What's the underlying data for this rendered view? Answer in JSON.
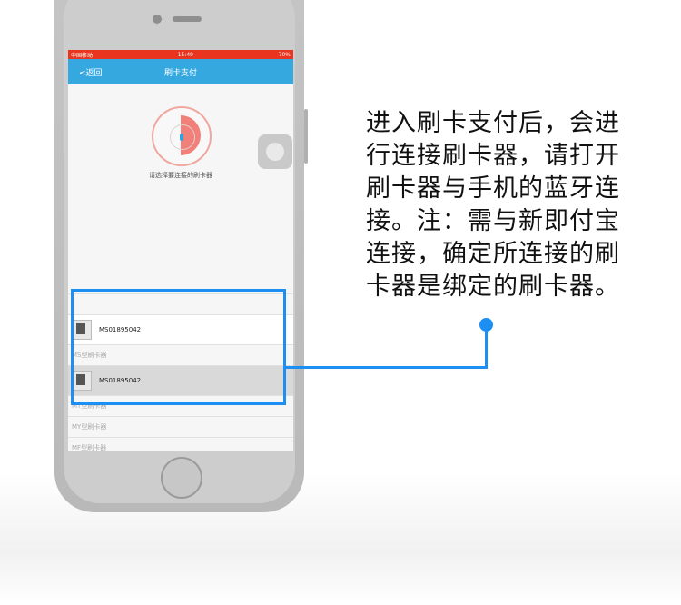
{
  "status": {
    "left": "中国移动",
    "time": "15:49",
    "right": "70%"
  },
  "nav": {
    "back_label": "<返回",
    "title": "刷卡支付"
  },
  "prompt": "请选择要连接的刷卡器",
  "devices": [
    {
      "id": "MS01895042",
      "selected": false
    },
    {
      "id": "MS01895042",
      "selected": true
    }
  ],
  "sections": [
    "MS型刷卡器",
    "MT型刷卡器",
    "MY型刷卡器",
    "MF型刷卡器"
  ],
  "annotation": "进入刷卡支付后，会进行连接刷卡器，请打开刷卡器与手机的蓝牙连接。注：需与新即付宝连接，确定所连接的刷卡器是绑定的刷卡器。",
  "colors": {
    "status_bar": "#e9341f",
    "nav_bar": "#35a8e0",
    "highlight": "#1e8ff2"
  }
}
